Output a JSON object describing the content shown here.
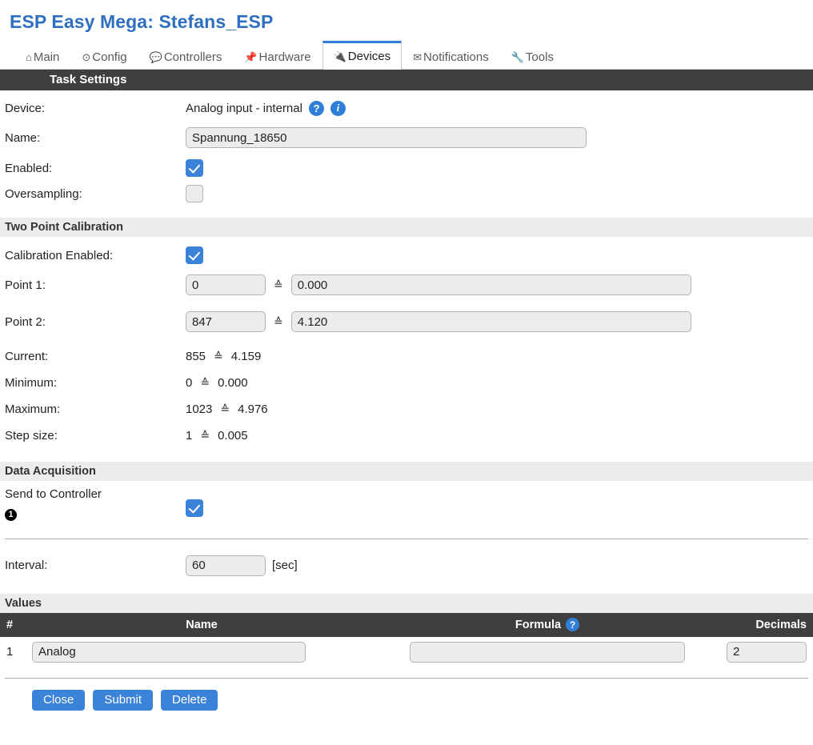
{
  "header": {
    "title": "ESP Easy Mega: Stefans_ESP"
  },
  "tabs": [
    {
      "label": "Main",
      "icon": "home-icon",
      "glyph": "⌂",
      "active": false
    },
    {
      "label": "Config",
      "icon": "gear-icon",
      "glyph": "⊙",
      "active": false
    },
    {
      "label": "Controllers",
      "icon": "speech-bubble-icon",
      "glyph": "💬",
      "active": false
    },
    {
      "label": "Hardware",
      "icon": "pushpin-icon",
      "glyph": "📌",
      "active": false
    },
    {
      "label": "Devices",
      "icon": "plug-icon",
      "glyph": "🔌",
      "active": true
    },
    {
      "label": "Notifications",
      "icon": "envelope-icon",
      "glyph": "✉",
      "active": false
    },
    {
      "label": "Tools",
      "icon": "wrench-icon",
      "glyph": "🔧",
      "active": false
    }
  ],
  "task_settings": {
    "section_title": "Task Settings",
    "device_label": "Device:",
    "device_value": "Analog input - internal",
    "help_icon": "?",
    "info_icon": "i",
    "name_label": "Name:",
    "name_value": "Spannung_18650",
    "enabled_label": "Enabled:",
    "enabled_checked": true,
    "oversampling_label": "Oversampling:",
    "oversampling_checked": false
  },
  "calibration": {
    "section_title": "Two Point Calibration",
    "enabled_label": "Calibration Enabled:",
    "enabled_checked": true,
    "equals_symbol": "≙",
    "point1_label": "Point 1:",
    "point1_raw": "0",
    "point1_value": "0.000",
    "point2_label": "Point 2:",
    "point2_raw": "847",
    "point2_value": "4.120",
    "readings": [
      {
        "label": "Current:",
        "raw": "855",
        "value": "4.159"
      },
      {
        "label": "Minimum:",
        "raw": "0",
        "value": "0.000"
      },
      {
        "label": "Maximum:",
        "raw": "1023",
        "value": "4.976"
      },
      {
        "label": "Step size:",
        "raw": "1",
        "value": "0.005"
      }
    ]
  },
  "data_acquisition": {
    "section_title": "Data Acquisition",
    "send_to_controller_label": "Send to Controller",
    "controller_index": "1",
    "send_checked": true,
    "interval_label": "Interval:",
    "interval_value": "60",
    "interval_unit": "[sec]"
  },
  "values": {
    "section_title": "Values",
    "columns": {
      "num": "#",
      "name": "Name",
      "formula": "Formula",
      "decimals": "Decimals"
    },
    "formula_help_icon": "?",
    "rows": [
      {
        "num": "1",
        "name": "Analog",
        "formula": "",
        "decimals": "2"
      }
    ]
  },
  "buttons": {
    "close": "Close",
    "submit": "Submit",
    "delete": "Delete"
  },
  "colors": {
    "accent_blue": "#3b82d9",
    "title_blue": "#2f6fc0",
    "dark_bar": "#3f3f3f",
    "light_bar": "#ececec",
    "field_bg": "#ececec"
  }
}
